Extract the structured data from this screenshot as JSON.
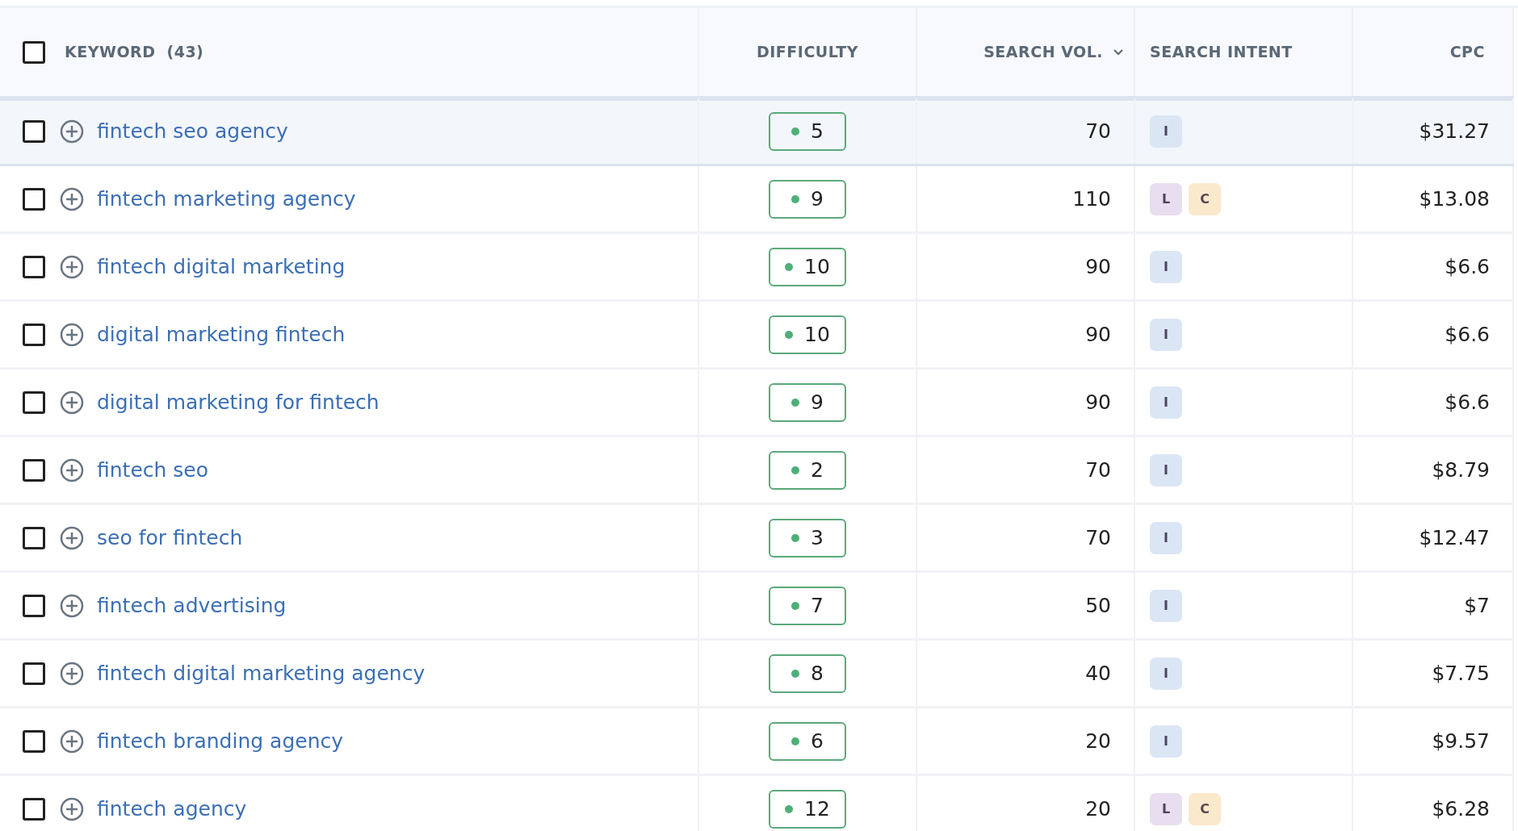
{
  "table": {
    "columns": [
      {
        "label": "KEYWORD",
        "count": "(43)",
        "kind": "keyword"
      },
      {
        "label": "DIFFICULTY",
        "kind": "difficulty"
      },
      {
        "label": "SEARCH VOL.",
        "kind": "volume",
        "sorted": true
      },
      {
        "label": "SEARCH INTENT",
        "kind": "intent"
      },
      {
        "label": "CPC",
        "kind": "cpc"
      }
    ],
    "header_checked": false,
    "rows": [
      {
        "checked": false,
        "hovered": true,
        "keyword": "fintech seo agency",
        "difficulty": "5",
        "volume": "70",
        "intent": [
          {
            "letter": "I",
            "color": "#dbe6f5"
          }
        ],
        "cpc": "$31.27"
      },
      {
        "checked": false,
        "hovered": false,
        "keyword": "fintech marketing agency",
        "difficulty": "9",
        "volume": "110",
        "intent": [
          {
            "letter": "L",
            "color": "#e9ddf0"
          },
          {
            "letter": "C",
            "color": "#fbe9cc"
          }
        ],
        "cpc": "$13.08"
      },
      {
        "checked": false,
        "hovered": false,
        "keyword": "fintech digital marketing",
        "difficulty": "10",
        "volume": "90",
        "intent": [
          {
            "letter": "I",
            "color": "#dbe6f5"
          }
        ],
        "cpc": "$6.6"
      },
      {
        "checked": false,
        "hovered": false,
        "keyword": "digital marketing fintech",
        "difficulty": "10",
        "volume": "90",
        "intent": [
          {
            "letter": "I",
            "color": "#dbe6f5"
          }
        ],
        "cpc": "$6.6"
      },
      {
        "checked": false,
        "hovered": false,
        "keyword": "digital marketing for fintech",
        "difficulty": "9",
        "volume": "90",
        "intent": [
          {
            "letter": "I",
            "color": "#dbe6f5"
          }
        ],
        "cpc": "$6.6"
      },
      {
        "checked": false,
        "hovered": false,
        "keyword": "fintech seo",
        "difficulty": "2",
        "volume": "70",
        "intent": [
          {
            "letter": "I",
            "color": "#dbe6f5"
          }
        ],
        "cpc": "$8.79"
      },
      {
        "checked": false,
        "hovered": false,
        "keyword": "seo for fintech",
        "difficulty": "3",
        "volume": "70",
        "intent": [
          {
            "letter": "I",
            "color": "#dbe6f5"
          }
        ],
        "cpc": "$12.47"
      },
      {
        "checked": false,
        "hovered": false,
        "keyword": "fintech advertising",
        "difficulty": "7",
        "volume": "50",
        "intent": [
          {
            "letter": "I",
            "color": "#dbe6f5"
          }
        ],
        "cpc": "$7"
      },
      {
        "checked": false,
        "hovered": false,
        "keyword": "fintech digital marketing agency",
        "difficulty": "8",
        "volume": "40",
        "intent": [
          {
            "letter": "I",
            "color": "#dbe6f5"
          }
        ],
        "cpc": "$7.75"
      },
      {
        "checked": false,
        "hovered": false,
        "keyword": "fintech branding agency",
        "difficulty": "6",
        "volume": "20",
        "intent": [
          {
            "letter": "I",
            "color": "#dbe6f5"
          }
        ],
        "cpc": "$9.57"
      },
      {
        "checked": false,
        "hovered": false,
        "keyword": "fintech agency",
        "difficulty": "12",
        "volume": "20",
        "intent": [
          {
            "letter": "L",
            "color": "#e9ddf0"
          },
          {
            "letter": "C",
            "color": "#fbe9cc"
          }
        ],
        "cpc": "$6.28"
      }
    ]
  }
}
